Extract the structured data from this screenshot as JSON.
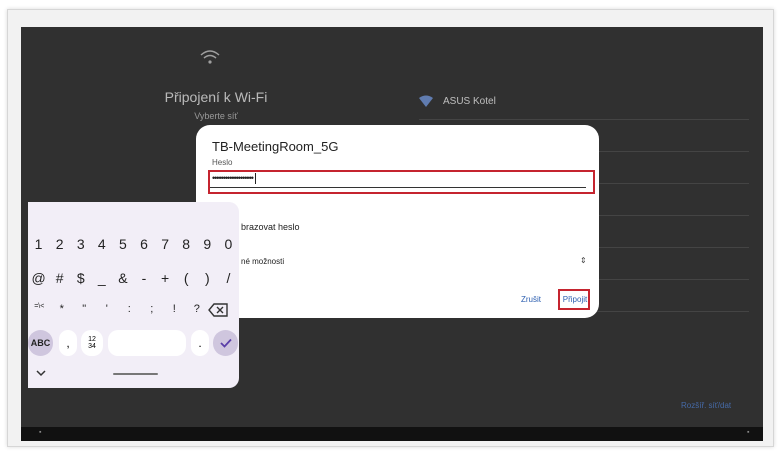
{
  "setup": {
    "title": "Připojení k Wi-Fi",
    "subtitle": "Vyberte síť",
    "network_name": "ASUS Kotel",
    "more_options": "Rozšíř. síť/dat",
    "wifi_icon": "wifi-icon"
  },
  "dialog": {
    "title": "TB-MeetingRoom_5G",
    "password_label": "Heslo",
    "password_value": "•••••••••••••••••••",
    "show_password": "brazovat heslo",
    "advanced": "né možnosti",
    "cancel": "Zrušit",
    "connect": "Připojit"
  },
  "keyboard": {
    "row1": [
      "1",
      "2",
      "3",
      "4",
      "5",
      "6",
      "7",
      "8",
      "9",
      "0"
    ],
    "row2": [
      "@",
      "#",
      "$",
      "_",
      "&",
      "-",
      "+",
      "(",
      ")",
      "/"
    ],
    "row3": [
      "=\\<",
      "*",
      "\"",
      "'",
      ":",
      ";",
      "!",
      "?"
    ],
    "abc": "ABC",
    "comma": ",",
    "numbers_top": "12",
    "numbers_bottom": "34",
    "period": "."
  },
  "colors": {
    "highlight": "#c5242f",
    "accent": "#2d5fb0",
    "keyboard_bg": "#f2eef7",
    "dark_bg": "#303030"
  }
}
